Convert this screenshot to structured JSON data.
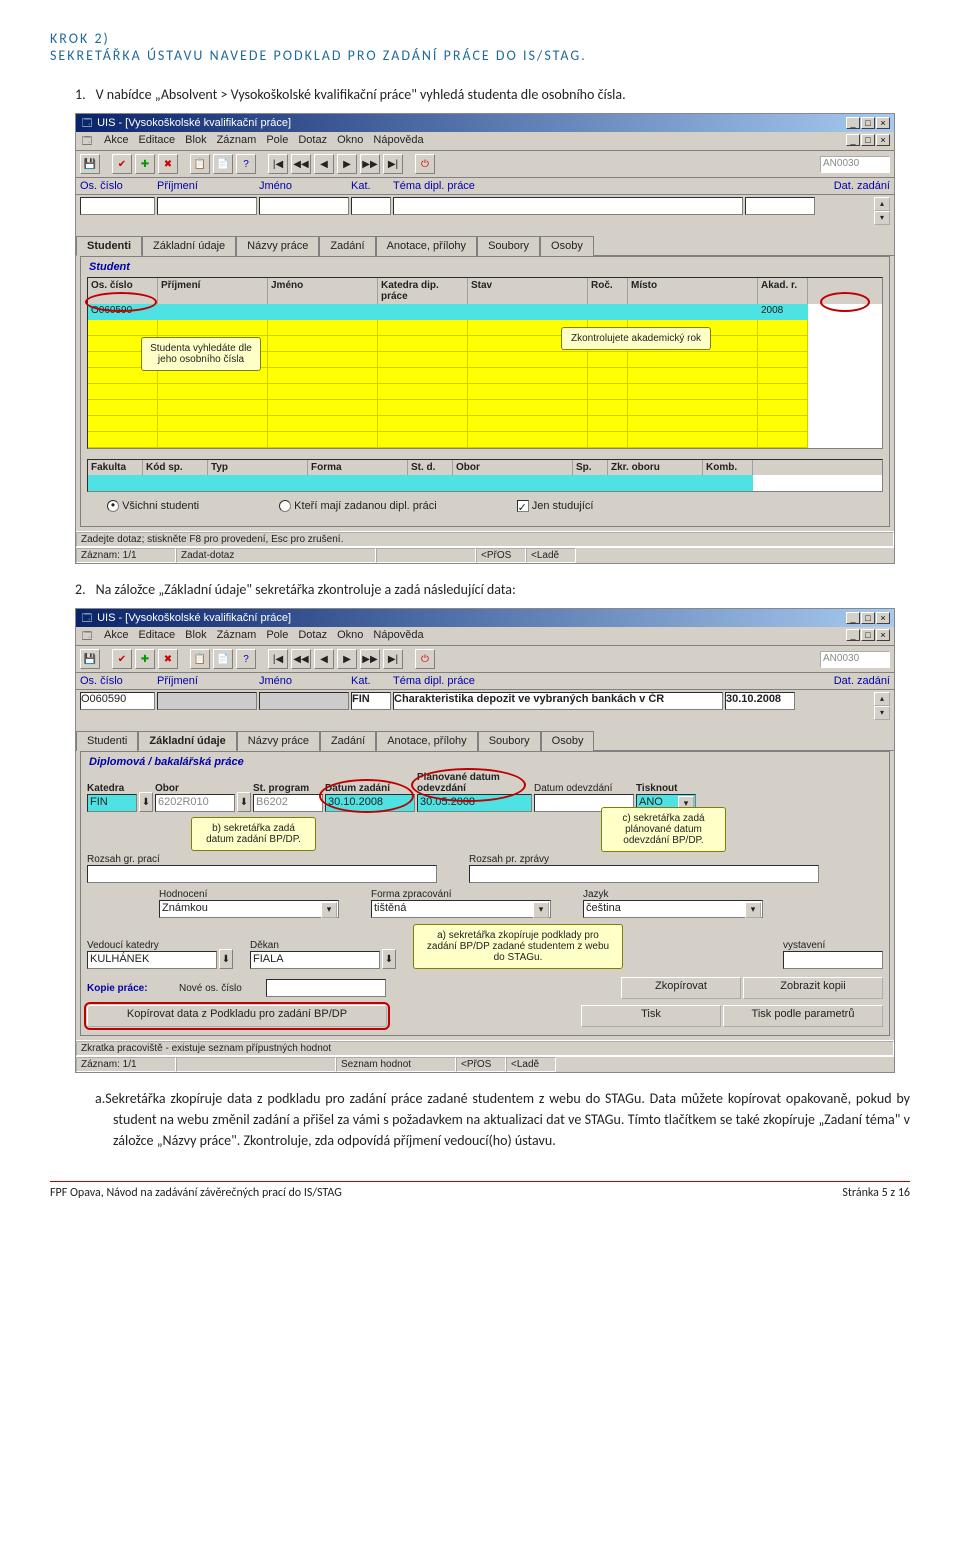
{
  "step": {
    "label": "KROK 2)",
    "subtitle": "SEKRETÁŘKA ÚSTAVU NAVEDE PODKLAD PRO ZADÁNÍ PRÁCE DO IS/STAG."
  },
  "instr1": {
    "num": "1.",
    "text": "V nabídce „Absolvent > Vysokoškolské kvalifikační práce\" vyhledá studenta dle osobního čísla."
  },
  "instr2": {
    "num": "2.",
    "text": "Na záložce „Základní údaje\" sekretářka zkontroluje a zadá následující data:"
  },
  "sub_a": {
    "num": "a.",
    "text": "Sekretářka zkopíruje data z podkladu pro zadání práce zadané studentem z webu do STAGu. Data můžete kopírovat opakovaně, pokud by student na webu změnil zadání a přišel za vámi s požadavkem na aktualizaci dat ve STAGu. Tímto tlačítkem se také zkopíruje „Zadaní téma\" v záložce „Názvy práce\". Zkontroluje, zda odpovídá příjmení vedoucí(ho) ústavu."
  },
  "win_title": "UIS - [Vysokoškolské kvalifikační práce]",
  "menu": [
    "Akce",
    "Editace",
    "Blok",
    "Záznam",
    "Pole",
    "Dotaz",
    "Okno",
    "Nápověda"
  ],
  "appcode": "AN0030",
  "search_cols": {
    "os": "Os. číslo",
    "prij": "Příjmení",
    "jm": "Jméno",
    "kat": "Kat.",
    "tema": "Téma dipl. práce",
    "dat": "Dat. zadání"
  },
  "tabs": [
    "Studenti",
    "Základní údaje",
    "Názvy práce",
    "Zadání",
    "Anotace, přílohy",
    "Soubory",
    "Osoby"
  ],
  "screen1": {
    "group_title": "Student",
    "grid_hdr": {
      "os": "Os. číslo",
      "prij": "Příjmení",
      "jm": "Jméno",
      "kat": "Katedra dip. práce",
      "stav": "Stav",
      "roc": "Roč.",
      "misto": "Místo",
      "akad": "Akad. r."
    },
    "os_val": "O060590",
    "ak_val": "2008",
    "callout_student": "Studenta vyhledáte dle jeho osobního čísla",
    "callout_rok": "Zkontrolujete akademický rok",
    "grid2_hdr": {
      "fak": "Fakulta",
      "kod": "Kód sp.",
      "typ": "Typ",
      "forma": "Forma",
      "std": "St. d.",
      "obor": "Obor",
      "sp": "Sp.",
      "zkr": "Zkr. oboru",
      "komb": "Komb."
    },
    "radio1": "Všichni studenti",
    "radio2": "Kteří mají zadanou dipl. práci",
    "check": "Jen studující",
    "status1": "Zadejte dotaz; stiskněte F8 pro provedení, Esc pro zrušení.",
    "status_row": [
      "Záznam: 1/1",
      "Zadat-dotaz",
      "",
      "<PřOS",
      "<Ladě"
    ]
  },
  "screen2": {
    "group_title": "Diplomová / bakalářská práce",
    "os_val": "O060590",
    "kat_val": "FIN",
    "tema_val": "Charakteristika depozit ve vybraných bankách v ČR",
    "dat_val": "30.10.2008",
    "row1": {
      "katedra": {
        "l": "Katedra",
        "v": "FIN"
      },
      "obor": {
        "l": "Obor",
        "v": "6202R010"
      },
      "prog": {
        "l": "St. program",
        "v": "B6202"
      },
      "dz": {
        "l": "Datum zadání",
        "v": "30.10.2008"
      },
      "pdo": {
        "l": "Plánované datum odevzdání",
        "v": "30.05.2008"
      },
      "dodev": {
        "l": "Datum odevzdání",
        "v": ""
      },
      "tisk": {
        "l": "Tisknout",
        "v": "ANO"
      }
    },
    "callout_b": "b) sekretářka zadá datum zadání BP/DP.",
    "callout_c": "c) sekretářka zadá plánované datum odevzdání BP/DP.",
    "callout_a": "a) sekretářka zkopíruje podklady pro zadání BP/DP zadané studentem z webu do STAGu.",
    "rozsah_gr": "Rozsah gr. prací",
    "rozsah_pr": "Rozsah pr. zprávy",
    "hodnoceni": {
      "l": "Hodnocení",
      "v": "Známkou"
    },
    "forma": {
      "l": "Forma zpracování",
      "v": "tištěná"
    },
    "jazyk": {
      "l": "Jazyk",
      "v": "čeština"
    },
    "ved": {
      "l": "Vedoucí katedry",
      "v": "KULHÁNEK"
    },
    "dekan": {
      "l": "Děkan",
      "v": "FIALA"
    },
    "vystaveni": "vystavení",
    "kopie": "Kopie práce:",
    "nove": "Nové os. číslo",
    "btn_zkop": "Zkopírovat",
    "btn_zobr": "Zobrazit kopii",
    "btn_podklad": "Kopírovat data z Podkladu pro zadání BP/DP",
    "btn_tisk": "Tisk",
    "btn_tiskp": "Tisk podle parametrů",
    "status1": "Zkratka pracoviště - existuje seznam přípustných hodnot",
    "status_row": [
      "Záznam: 1/1",
      "",
      "Seznam hodnot",
      "<PřOS",
      "<Ladě"
    ]
  },
  "footer": {
    "left": "FPF Opava, Návod na zadávání závěrečných prací do IS/STAG",
    "right": "Stránka 5 z 16"
  }
}
